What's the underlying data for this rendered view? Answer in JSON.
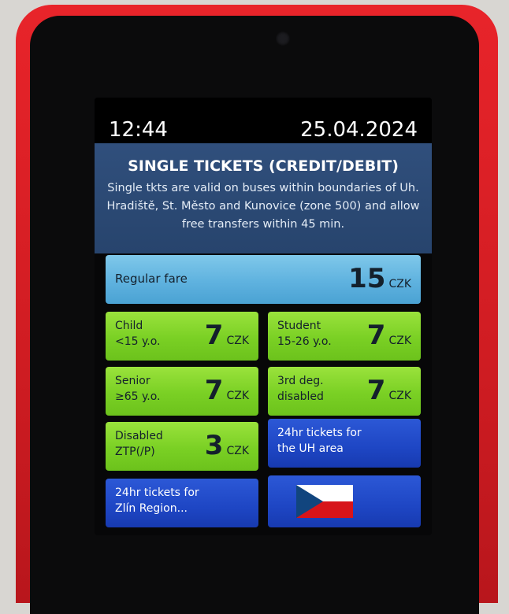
{
  "status_bar": {
    "time": "12:44",
    "date": "25.04.2024"
  },
  "header": {
    "title": "SINGLE TICKETS (CREDIT/DEBIT)",
    "description": "Single tkts are valid on buses within boundaries of Uh. Hradiště, St. Město and Kunovice (zone 500) and allow free transfers within 45 min."
  },
  "currency": "CZK",
  "fares": {
    "regular": {
      "label": "Regular fare",
      "price": "15"
    },
    "child": {
      "line1": "Child",
      "line2": "<15 y.o.",
      "price": "7"
    },
    "student": {
      "line1": "Student",
      "line2": "15-26 y.o.",
      "price": "7"
    },
    "senior": {
      "line1": "Senior",
      "line2": "≥65 y.o.",
      "price": "7"
    },
    "disabled3": {
      "line1": "3rd deg.",
      "line2": "disabled",
      "price": "7"
    },
    "ztp": {
      "line1": "Disabled",
      "line2": "ZTP(/P)",
      "price": "3"
    }
  },
  "links": {
    "uh_area": {
      "line1": "24hr tickets for",
      "line2": "the UH area"
    },
    "zlin": {
      "line1": "24hr tickets for",
      "line2": "Zlín Region..."
    }
  },
  "language": {
    "icon": "czech-flag-icon",
    "colors": [
      "#ffffff",
      "#d7141a",
      "#11457e"
    ]
  }
}
